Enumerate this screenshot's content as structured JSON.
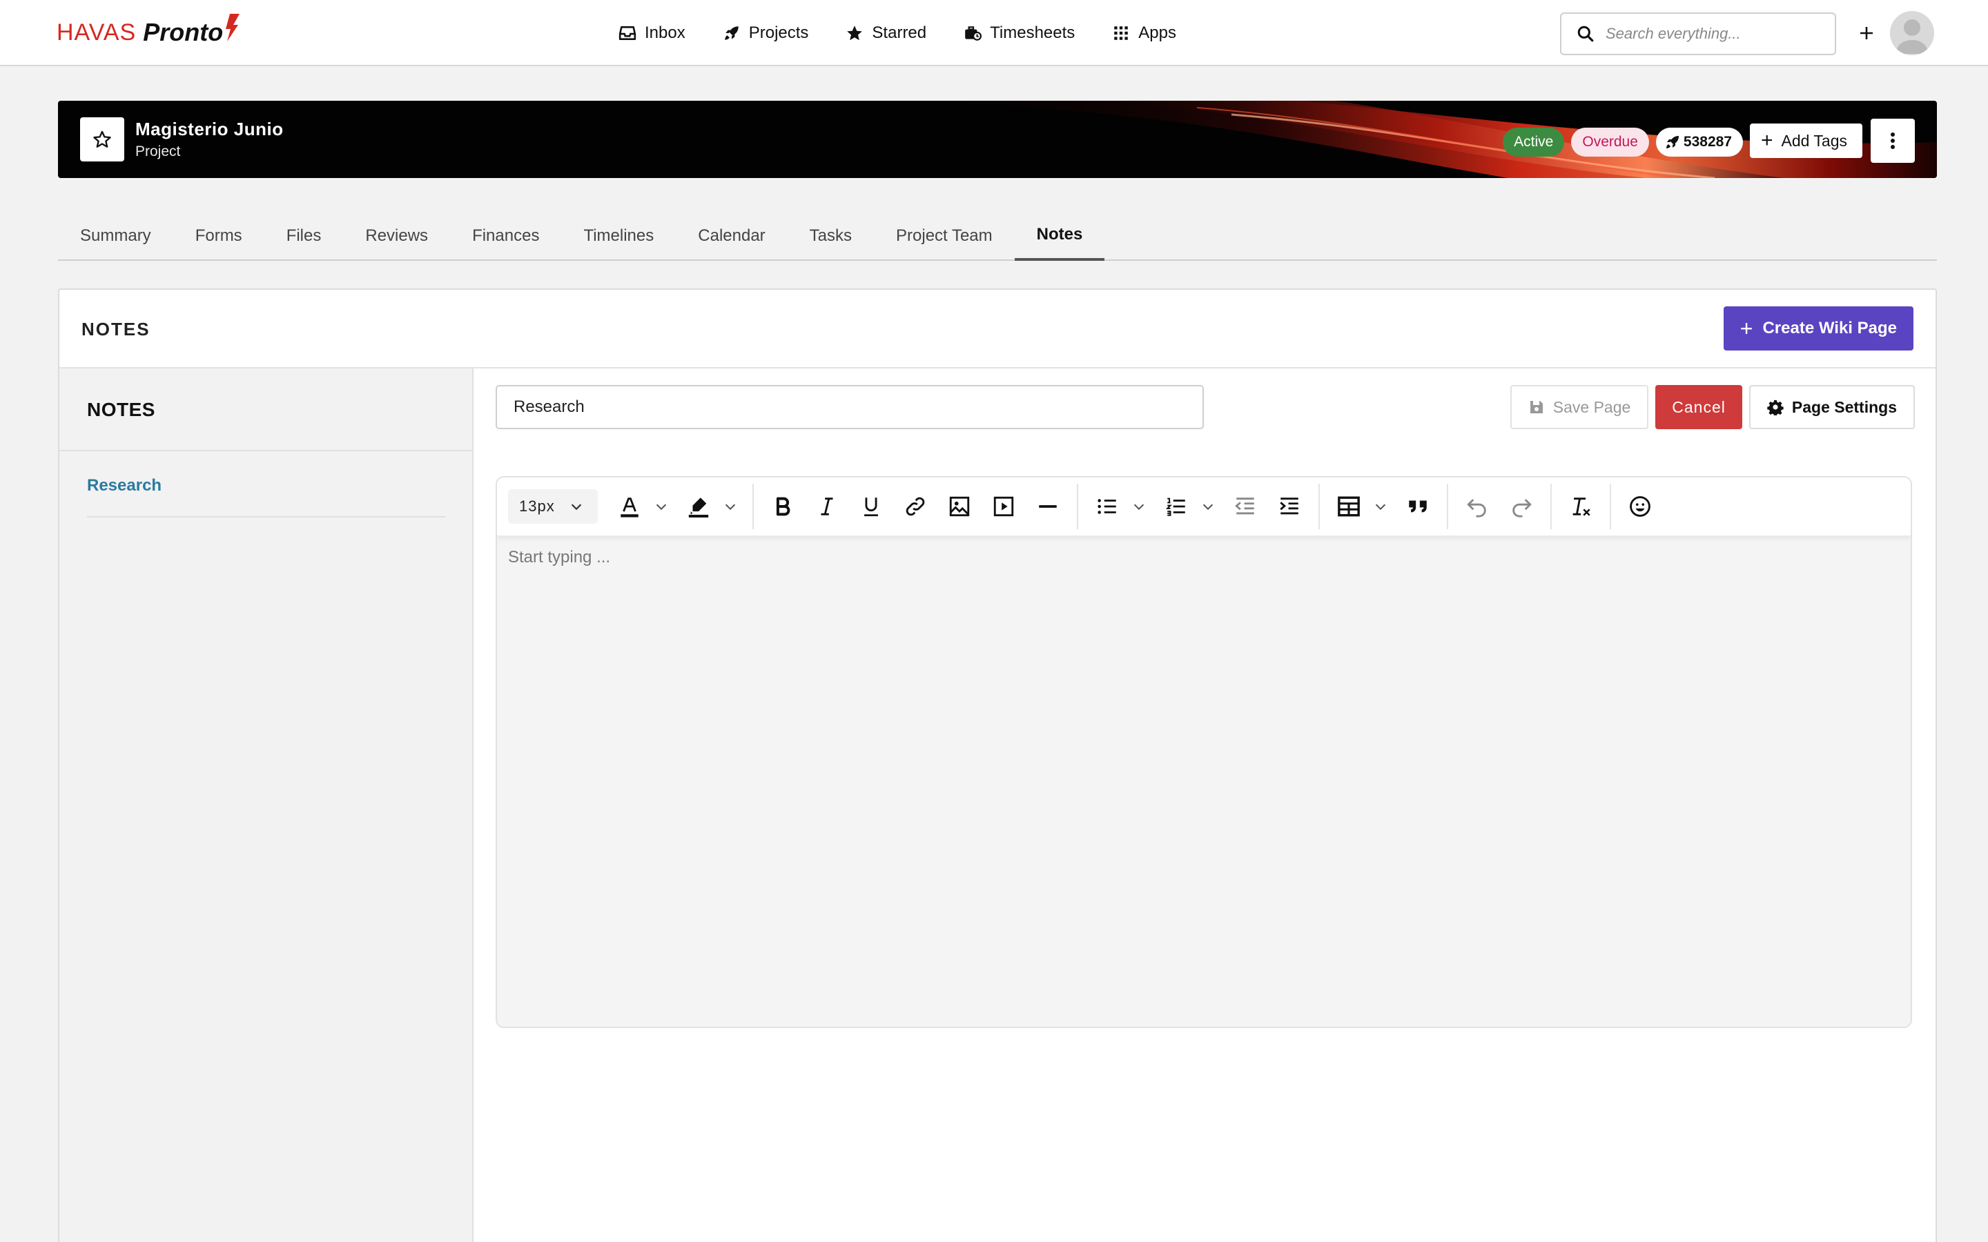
{
  "brand": {
    "name_part1": "HAVAS",
    "name_part2": "Pronto"
  },
  "nav": [
    {
      "label": "Inbox",
      "icon": "inbox-icon"
    },
    {
      "label": "Projects",
      "icon": "rocket-icon"
    },
    {
      "label": "Starred",
      "icon": "star-icon"
    },
    {
      "label": "Timesheets",
      "icon": "timesheet-icon"
    },
    {
      "label": "Apps",
      "icon": "grid-icon"
    }
  ],
  "search": {
    "placeholder": "Search everything..."
  },
  "project": {
    "name": "Magisterio Junio",
    "type": "Project",
    "status": "Active",
    "flag": "Overdue",
    "id": "538287",
    "add_tags_label": "Add Tags"
  },
  "tabs": [
    "Summary",
    "Forms",
    "Files",
    "Reviews",
    "Finances",
    "Timelines",
    "Calendar",
    "Tasks",
    "Project Team",
    "Notes"
  ],
  "active_tab": "Notes",
  "panel": {
    "title": "NOTES",
    "create_label": "Create Wiki Page"
  },
  "sidebar": {
    "title": "NOTES",
    "items": [
      {
        "label": "Research"
      }
    ]
  },
  "editor": {
    "page_title_value": "Research",
    "save_label": "Save Page",
    "cancel_label": "Cancel",
    "settings_label": "Page Settings",
    "font_size": "13px",
    "placeholder": "Start typing ..."
  },
  "colors": {
    "brand_red": "#d5281f",
    "active_green": "#3d8b41",
    "overdue_pink": "#c2185b",
    "create_purple": "#5a44c2",
    "cancel_red": "#cf3a3a",
    "link_teal": "#2a7aa0"
  }
}
